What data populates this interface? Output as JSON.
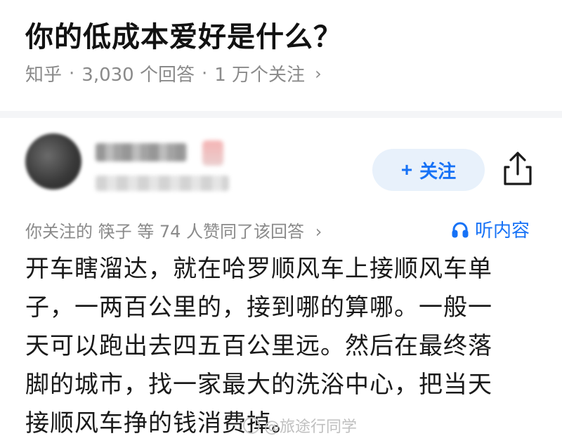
{
  "question": {
    "title": "你的低成本爱好是什么？",
    "source": "知乎",
    "separator": "·",
    "answer_count": "3,030 个回答",
    "follower_count": "1 万个关注",
    "chevron": "›"
  },
  "author": {
    "name": "",
    "bio": ""
  },
  "actions": {
    "follow_plus": "+",
    "follow_label": "关注",
    "share_icon": "share-icon"
  },
  "social_proof": {
    "text": "你关注的 筷子 等 74 人赞同了该回答",
    "chevron": "›"
  },
  "listen": {
    "label": "听内容",
    "icon": "headphones-icon"
  },
  "answer": {
    "lines": [
      "开车瞎溜达，就在哈罗顺风车上接顺风车单",
      "子，一两百公里的，接到哪的算哪。一般一",
      "天可以跑出去四五百公里远。然后在最终落",
      "脚的城市，找一家最大的洗浴中心，把当天",
      "接顺风车挣的钱消费掉。"
    ]
  },
  "watermark": {
    "text": "@旅途行同学"
  },
  "colors": {
    "accent": "#1772f6",
    "follow_bg": "#e8f1fb",
    "muted": "#8a8a8a"
  }
}
